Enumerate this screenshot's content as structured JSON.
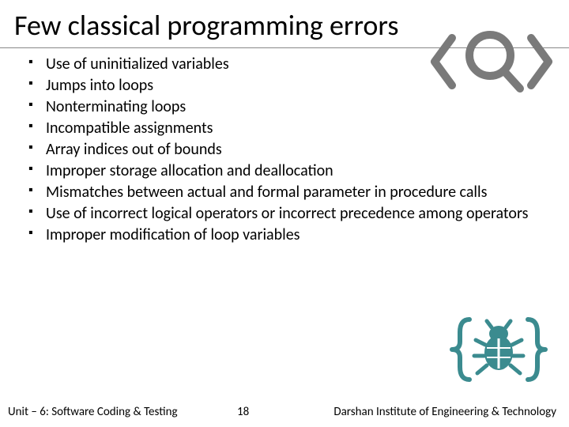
{
  "title": "Few classical programming errors",
  "bullets": [
    "Use of uninitialized variables",
    "Jumps into loops",
    "Nonterminating loops",
    "Incompatible assignments",
    "Array indices out of bounds",
    "Improper storage allocation and deallocation",
    "Mismatches between actual and formal parameter in procedure calls",
    "Use of incorrect logical operators or incorrect precedence among operators",
    "Improper modification of loop variables"
  ],
  "footer": {
    "left": "Unit – 6: Software Coding & Testing",
    "page": "18",
    "right": "Darshan Institute of Engineering & Technology"
  },
  "icons": {
    "search": "code-search-icon",
    "bug": "bug-braces-icon"
  },
  "colors": {
    "searchIcon": "#7a7a7a",
    "bugIcon": "#3b8b8f"
  }
}
